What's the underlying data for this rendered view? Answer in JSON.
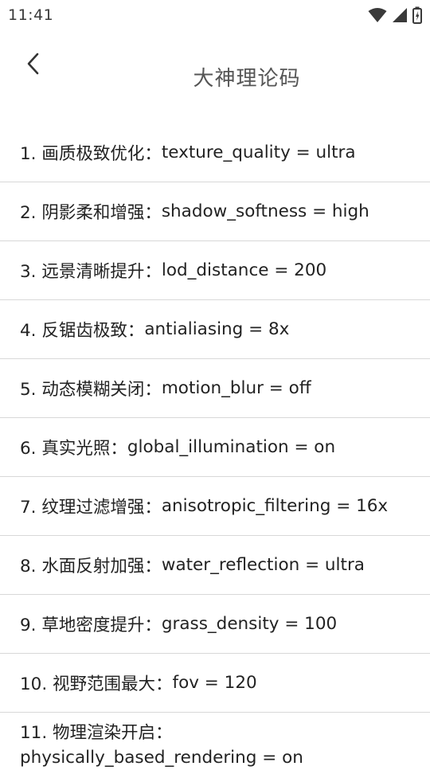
{
  "status_bar": {
    "time": "11:41",
    "icons": [
      "wifi-icon",
      "signal-icon",
      "battery-icon"
    ]
  },
  "header": {
    "back_icon": "chevron-left-icon",
    "title": "大神理论码"
  },
  "codes": [
    {
      "label": "1. 画质极致优化：",
      "value": "texture_quality = ultra"
    },
    {
      "label": "2. 阴影柔和增强：",
      "value": "shadow_softness = high"
    },
    {
      "label": "3. 远景清晰提升：",
      "value": "lod_distance = 200"
    },
    {
      "label": "4. 反锯齿极致：",
      "value": "antialiasing = 8x"
    },
    {
      "label": "5. 动态模糊关闭：",
      "value": "motion_blur = off"
    },
    {
      "label": "6. 真实光照：",
      "value": "global_illumination = on"
    },
    {
      "label": "7. 纹理过滤增强：",
      "value": "anisotropic_filtering = 16x"
    },
    {
      "label": "8. 水面反射加强：",
      "value": "water_reflection = ultra"
    },
    {
      "label": "9. 草地密度提升：",
      "value": "grass_density = 100"
    },
    {
      "label": "10. 视野范围最大：",
      "value": "fov = 120"
    },
    {
      "label": "11. 物理渲染开启：",
      "value": "physically_based_rendering = on"
    }
  ],
  "colors": {
    "background": "#ffffff",
    "text": "#222222",
    "title": "#555555",
    "divider": "#d8d8d8"
  }
}
